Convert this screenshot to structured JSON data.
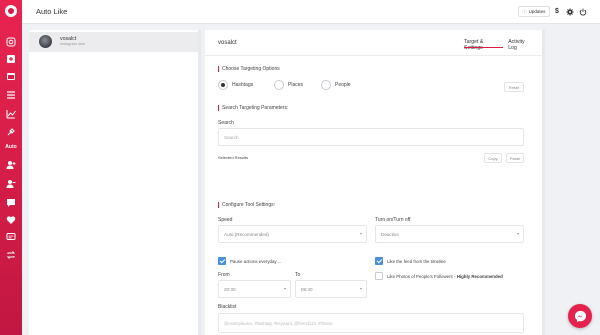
{
  "app": {
    "title": "Auto Like"
  },
  "topbar": {
    "updates_label": "Updates",
    "dollar_symbol": "$"
  },
  "rail": {
    "auto_label": "Auto"
  },
  "account": {
    "name": "vosalct",
    "type": "Instagram user"
  },
  "main": {
    "title": "vosalct",
    "tabs": [
      {
        "label": "Target & Settings",
        "active": true
      },
      {
        "label": "Activity Log",
        "active": false
      }
    ]
  },
  "targeting": {
    "section_title": "Choose Targeting Options",
    "options": [
      {
        "label": "Hashtags",
        "selected": true
      },
      {
        "label": "Places",
        "selected": false
      },
      {
        "label": "People",
        "selected": false
      }
    ],
    "reset_label": "Reset"
  },
  "search": {
    "section_title": "Search Targeting Parameters:",
    "label": "Search",
    "placeholder": "Search",
    "selected_results_label": "Selected Results",
    "copy_label": "Copy",
    "paste_label": "Paste"
  },
  "tool_settings": {
    "section_title": "Configure Tool Settings:",
    "speed_label": "Speed",
    "speed_value": "Auto (Recommended)",
    "onoff_label": "Turn on/Turn off",
    "onoff_value": "Deactive",
    "pause_label": "Pause actions everyday ...",
    "pause_checked": true,
    "like_feed_label": "Like the feed from the timeline",
    "like_feed_checked": true,
    "like_followers_label": "Like Photos of People's Followers -",
    "like_followers_emphasis": "Highly Recommended",
    "like_followers_checked": false,
    "from_label": "From",
    "from_value": "20:30",
    "to_label": "To",
    "to_value": "09:30",
    "blacklist_label": "Blacklist",
    "blacklist_placeholder": "@exampleuser, #hashtag, #keyword, @friend123, #fitness"
  },
  "colors": {
    "accent": "#d81e48",
    "checkbox": "#4a90d9"
  }
}
